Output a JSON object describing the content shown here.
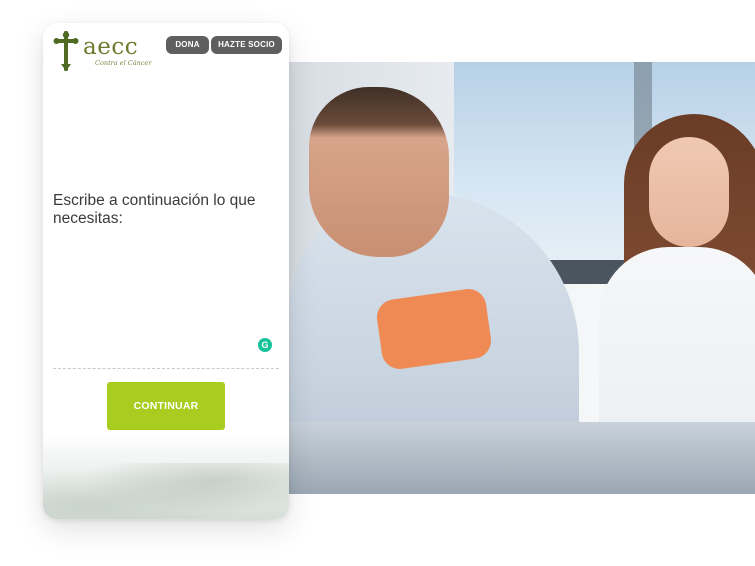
{
  "brand": {
    "name": "aecc",
    "tagline": "Contra el Cáncer",
    "accent": "#a8cc1f",
    "logo_color": "#6b7c2f"
  },
  "header": {
    "dona_label": "DONA",
    "socio_label": "HAZTE SOCIO"
  },
  "form": {
    "prompt": "Escribe a continuación lo que necesitas:",
    "textarea_value": "",
    "continue_label": "CONTINUAR"
  },
  "widgets": {
    "grammarly_icon": "grammarly-icon",
    "grammarly_glyph": "G"
  },
  "icons": {
    "logo": "aecc-cross-logo-icon"
  }
}
